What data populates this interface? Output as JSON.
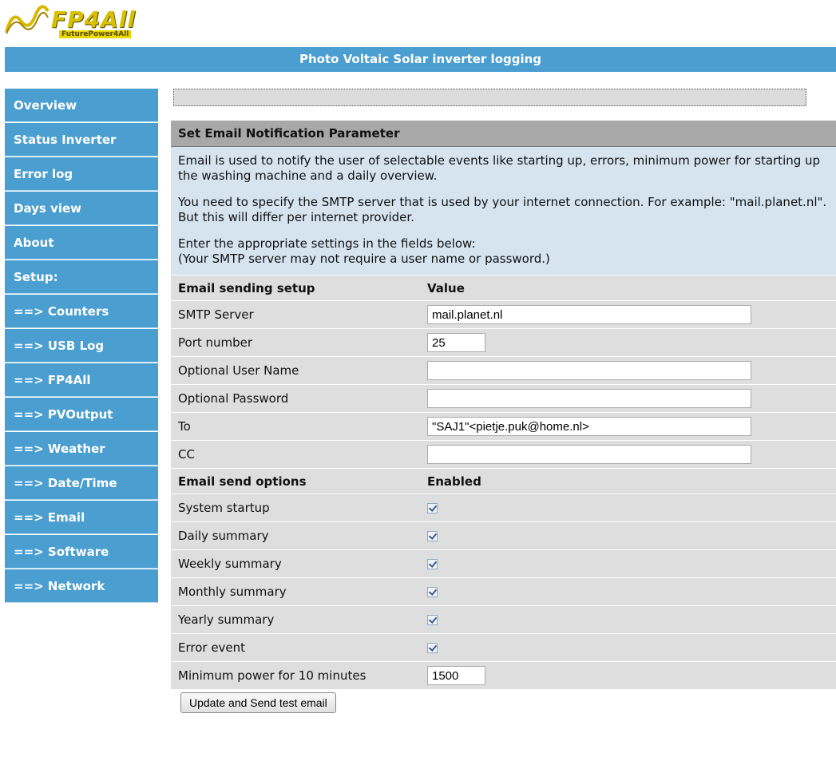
{
  "logo": {
    "name": "FP4All",
    "tagline": "FuturePower4All"
  },
  "title": "Photo Voltaic Solar inverter logging",
  "sidebar": {
    "items": [
      {
        "label": "Overview"
      },
      {
        "label": "Status Inverter"
      },
      {
        "label": "Error log"
      },
      {
        "label": "Days view"
      },
      {
        "label": "About"
      },
      {
        "label": "Setup:"
      },
      {
        "label": "==> Counters"
      },
      {
        "label": "==> USB Log"
      },
      {
        "label": "==> FP4All"
      },
      {
        "label": "==> PVOutput"
      },
      {
        "label": "==> Weather"
      },
      {
        "label": "==> Date/Time"
      },
      {
        "label": "==> Email"
      },
      {
        "label": "==> Software"
      },
      {
        "label": "==> Network"
      }
    ]
  },
  "panel": {
    "heading": "Set Email Notification Parameter",
    "desc1": "Email is used to notify the user of selectable events like starting up, errors, minimum power for starting up the washing machine and a daily overview.",
    "desc2": "You need to specify the SMTP server that is used by your internet connection. For example: \"mail.planet.nl\". But this will differ per internet provider.",
    "desc3a": "Enter the appropriate settings in the fields below:",
    "desc3b": "(Your SMTP server may not require a user name or password.)"
  },
  "sending": {
    "header_label": "Email sending setup",
    "header_value": "Value",
    "smtp_label": "SMTP Server",
    "smtp_value": "mail.planet.nl",
    "port_label": "Port number",
    "port_value": "25",
    "user_label": "Optional User Name",
    "user_value": "",
    "pass_label": "Optional Password",
    "pass_value": "",
    "to_label": "To",
    "to_value": "\"SAJ1\"<pietje.puk@home.nl>",
    "cc_label": "CC",
    "cc_value": ""
  },
  "options": {
    "header_label": "Email send options",
    "header_value": "Enabled",
    "items": [
      {
        "label": "System startup",
        "checked": true
      },
      {
        "label": "Daily summary",
        "checked": true
      },
      {
        "label": "Weekly summary",
        "checked": true
      },
      {
        "label": "Monthly summary",
        "checked": true
      },
      {
        "label": "Yearly summary",
        "checked": true
      },
      {
        "label": "Error event",
        "checked": true
      }
    ],
    "minpower_label": "Minimum power for 10 minutes",
    "minpower_value": "1500"
  },
  "button_label": "Update and Send test email"
}
